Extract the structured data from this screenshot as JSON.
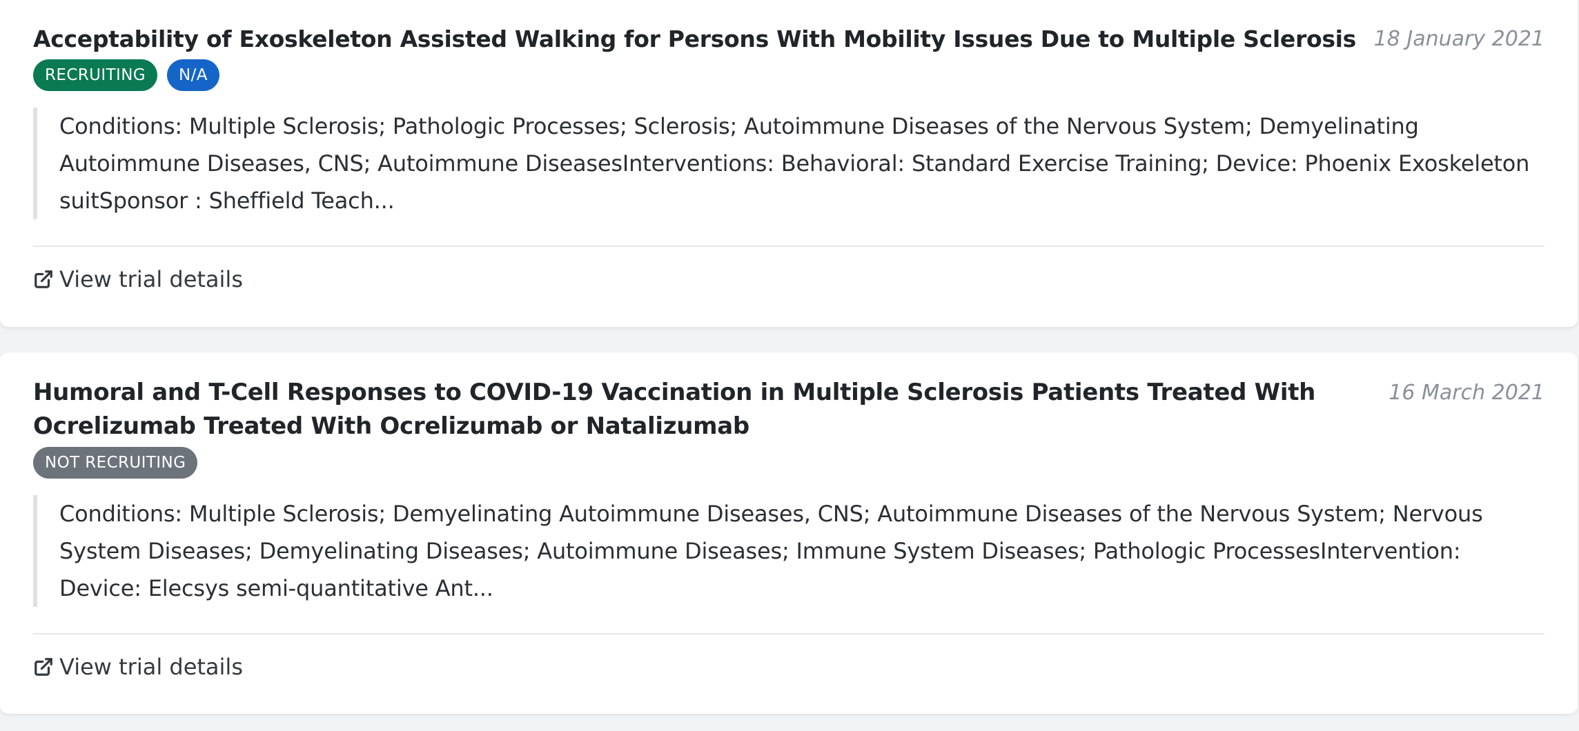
{
  "trials": [
    {
      "title": "Acceptability of Exoskeleton Assisted Walking for Persons With Mobility Issues Due to Multiple Sclerosis",
      "date": "18 January 2021",
      "badges": [
        {
          "label": "RECRUITING",
          "color": "#0a7a52"
        },
        {
          "label": "N/A",
          "color": "#1565c9"
        }
      ],
      "summary": "Conditions:   Multiple Sclerosis;   Pathologic Processes;   Sclerosis;   Autoimmune Diseases of the Nervous System;   Demyelinating Autoimmune Diseases, CNS;   Autoimmune DiseasesInterventions:   Behavioral: Standard Exercise Training;   Device: Phoenix Exoskeleton suitSponsor :   Sheffield Teach...",
      "link_label": "View trial details",
      "link_icon": "external-link-icon"
    },
    {
      "title": "Humoral and T-Cell Responses to COVID-19 Vaccination in Multiple Sclerosis Patients Treated With Ocrelizumab Treated With Ocrelizumab or Natalizumab",
      "date": "16 March 2021",
      "badges": [
        {
          "label": "NOT RECRUITING",
          "color": "#6c737b"
        }
      ],
      "summary": "Conditions:   Multiple Sclerosis;   Demyelinating Autoimmune Diseases, CNS;   Autoimmune Diseases of the Nervous System;   Nervous System Diseases;   Demyelinating Diseases;   Autoimmune Diseases;   Immune System Diseases;   Pathologic ProcessesIntervention:   Device: Elecsys semi-quantitative Ant...",
      "link_label": "View trial details",
      "link_icon": "external-link-icon"
    }
  ]
}
